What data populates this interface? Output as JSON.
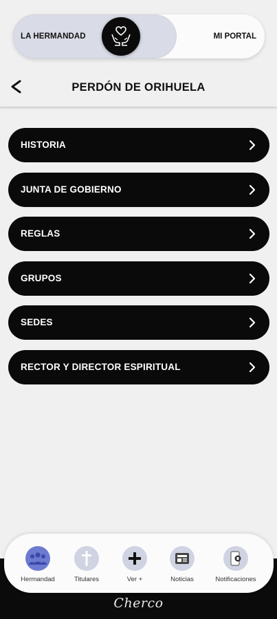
{
  "toggle": {
    "left_label": "LA HERMANDAD",
    "right_label": "MI PORTAL",
    "selected": "LA HERMANDAD"
  },
  "header": {
    "title": "PERDÓN DE ORIHUELA"
  },
  "menu": {
    "items": [
      {
        "label": "HISTORIA"
      },
      {
        "label": "JUNTA DE GOBIERNO"
      },
      {
        "label": "REGLAS"
      },
      {
        "label": "GRUPOS"
      },
      {
        "label": "SEDES"
      },
      {
        "label": "RECTOR Y DIRECTOR ESPIRITUAL"
      }
    ]
  },
  "bottom_nav": {
    "items": [
      {
        "label": "Hermandad",
        "icon": "people-group-icon",
        "active": true
      },
      {
        "label": "Titulares",
        "icon": "cross-icon",
        "active": false
      },
      {
        "label": "Ver +",
        "icon": "plus-icon",
        "active": false
      },
      {
        "label": "Noticias",
        "icon": "newspaper-icon",
        "active": false
      },
      {
        "label": "Notificaciones",
        "icon": "phone-notification-icon",
        "active": false
      }
    ]
  },
  "brand": {
    "text": "Cherco"
  },
  "colors": {
    "background": "#f0f0f1",
    "menu_item_bg": "#0a0a0a",
    "active_nav": "#6c7bd0",
    "inactive_nav": "#cfd3e2"
  }
}
